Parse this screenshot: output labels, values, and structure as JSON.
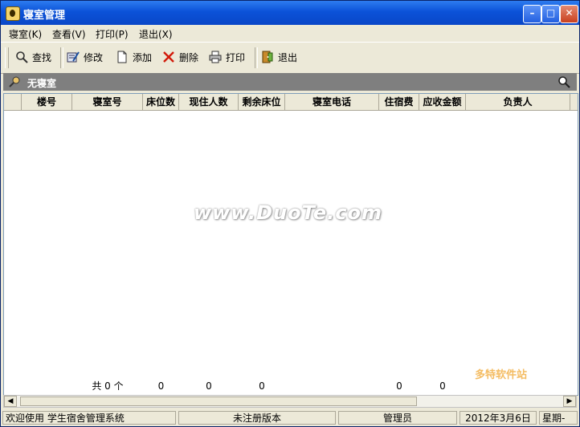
{
  "window": {
    "title": "寝室管理"
  },
  "menu": [
    {
      "label": "寝室(K)"
    },
    {
      "label": "查看(V)"
    },
    {
      "label": "打印(P)"
    },
    {
      "label": "退出(X)"
    }
  ],
  "toolbar": {
    "search": "查找",
    "edit": "修改",
    "add": "添加",
    "delete": "删除",
    "print": "打印",
    "exit": "退出"
  },
  "panel": {
    "title": "无寝室"
  },
  "table": {
    "columns": [
      "楼号",
      "寝室号",
      "床位数",
      "现住人数",
      "剩余床位",
      "寝室电话",
      "住宿费",
      "应收金额",
      "负责人"
    ],
    "footer": {
      "count_label": "共 0 个",
      "beds": "0",
      "occupants": "0",
      "free_beds": "0",
      "fee": "0",
      "receivable": "0"
    }
  },
  "watermark": {
    "text": "www.DuoTe.com",
    "text2": "多特软件站"
  },
  "status": {
    "welcome": "欢迎使用  学生宿舍管理系统",
    "version": "未注册版本",
    "user": "管理员",
    "date": "2012年3月6日",
    "weekday": "星期-"
  }
}
